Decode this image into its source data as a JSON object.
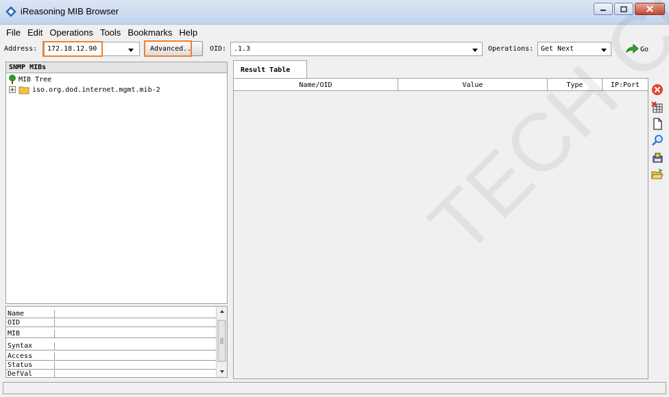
{
  "window": {
    "title": "iReasoning MIB Browser"
  },
  "menu": [
    "File",
    "Edit",
    "Operations",
    "Tools",
    "Bookmarks",
    "Help"
  ],
  "toolbar": {
    "address_label": "Address:",
    "address_value": "172.18.12.90",
    "advanced_label": "Advanced..",
    "oid_label": "OID:",
    "oid_value": ".1.3",
    "operations_label": "Operations:",
    "operations_value": "Get Next",
    "go_label": "Go",
    "highlight_color": "#f07f2a"
  },
  "left_panel": {
    "header": "SNMP MIBs",
    "tree_root": "MIB Tree",
    "tree_child": "iso.org.dod.internet.mgmt.mib-2",
    "properties": [
      "Name",
      "OID",
      "MIB",
      "Syntax",
      "Access",
      "Status",
      "DefVal"
    ]
  },
  "right_panel": {
    "tab": "Result Table",
    "columns": [
      "Name/OID",
      "Value",
      "Type",
      "IP:Port"
    ]
  },
  "side_icons": [
    "stop-icon",
    "clear-table-icon",
    "new-document-icon",
    "find-icon",
    "export-icon",
    "open-folder-icon"
  ],
  "watermark": "TECH CO"
}
